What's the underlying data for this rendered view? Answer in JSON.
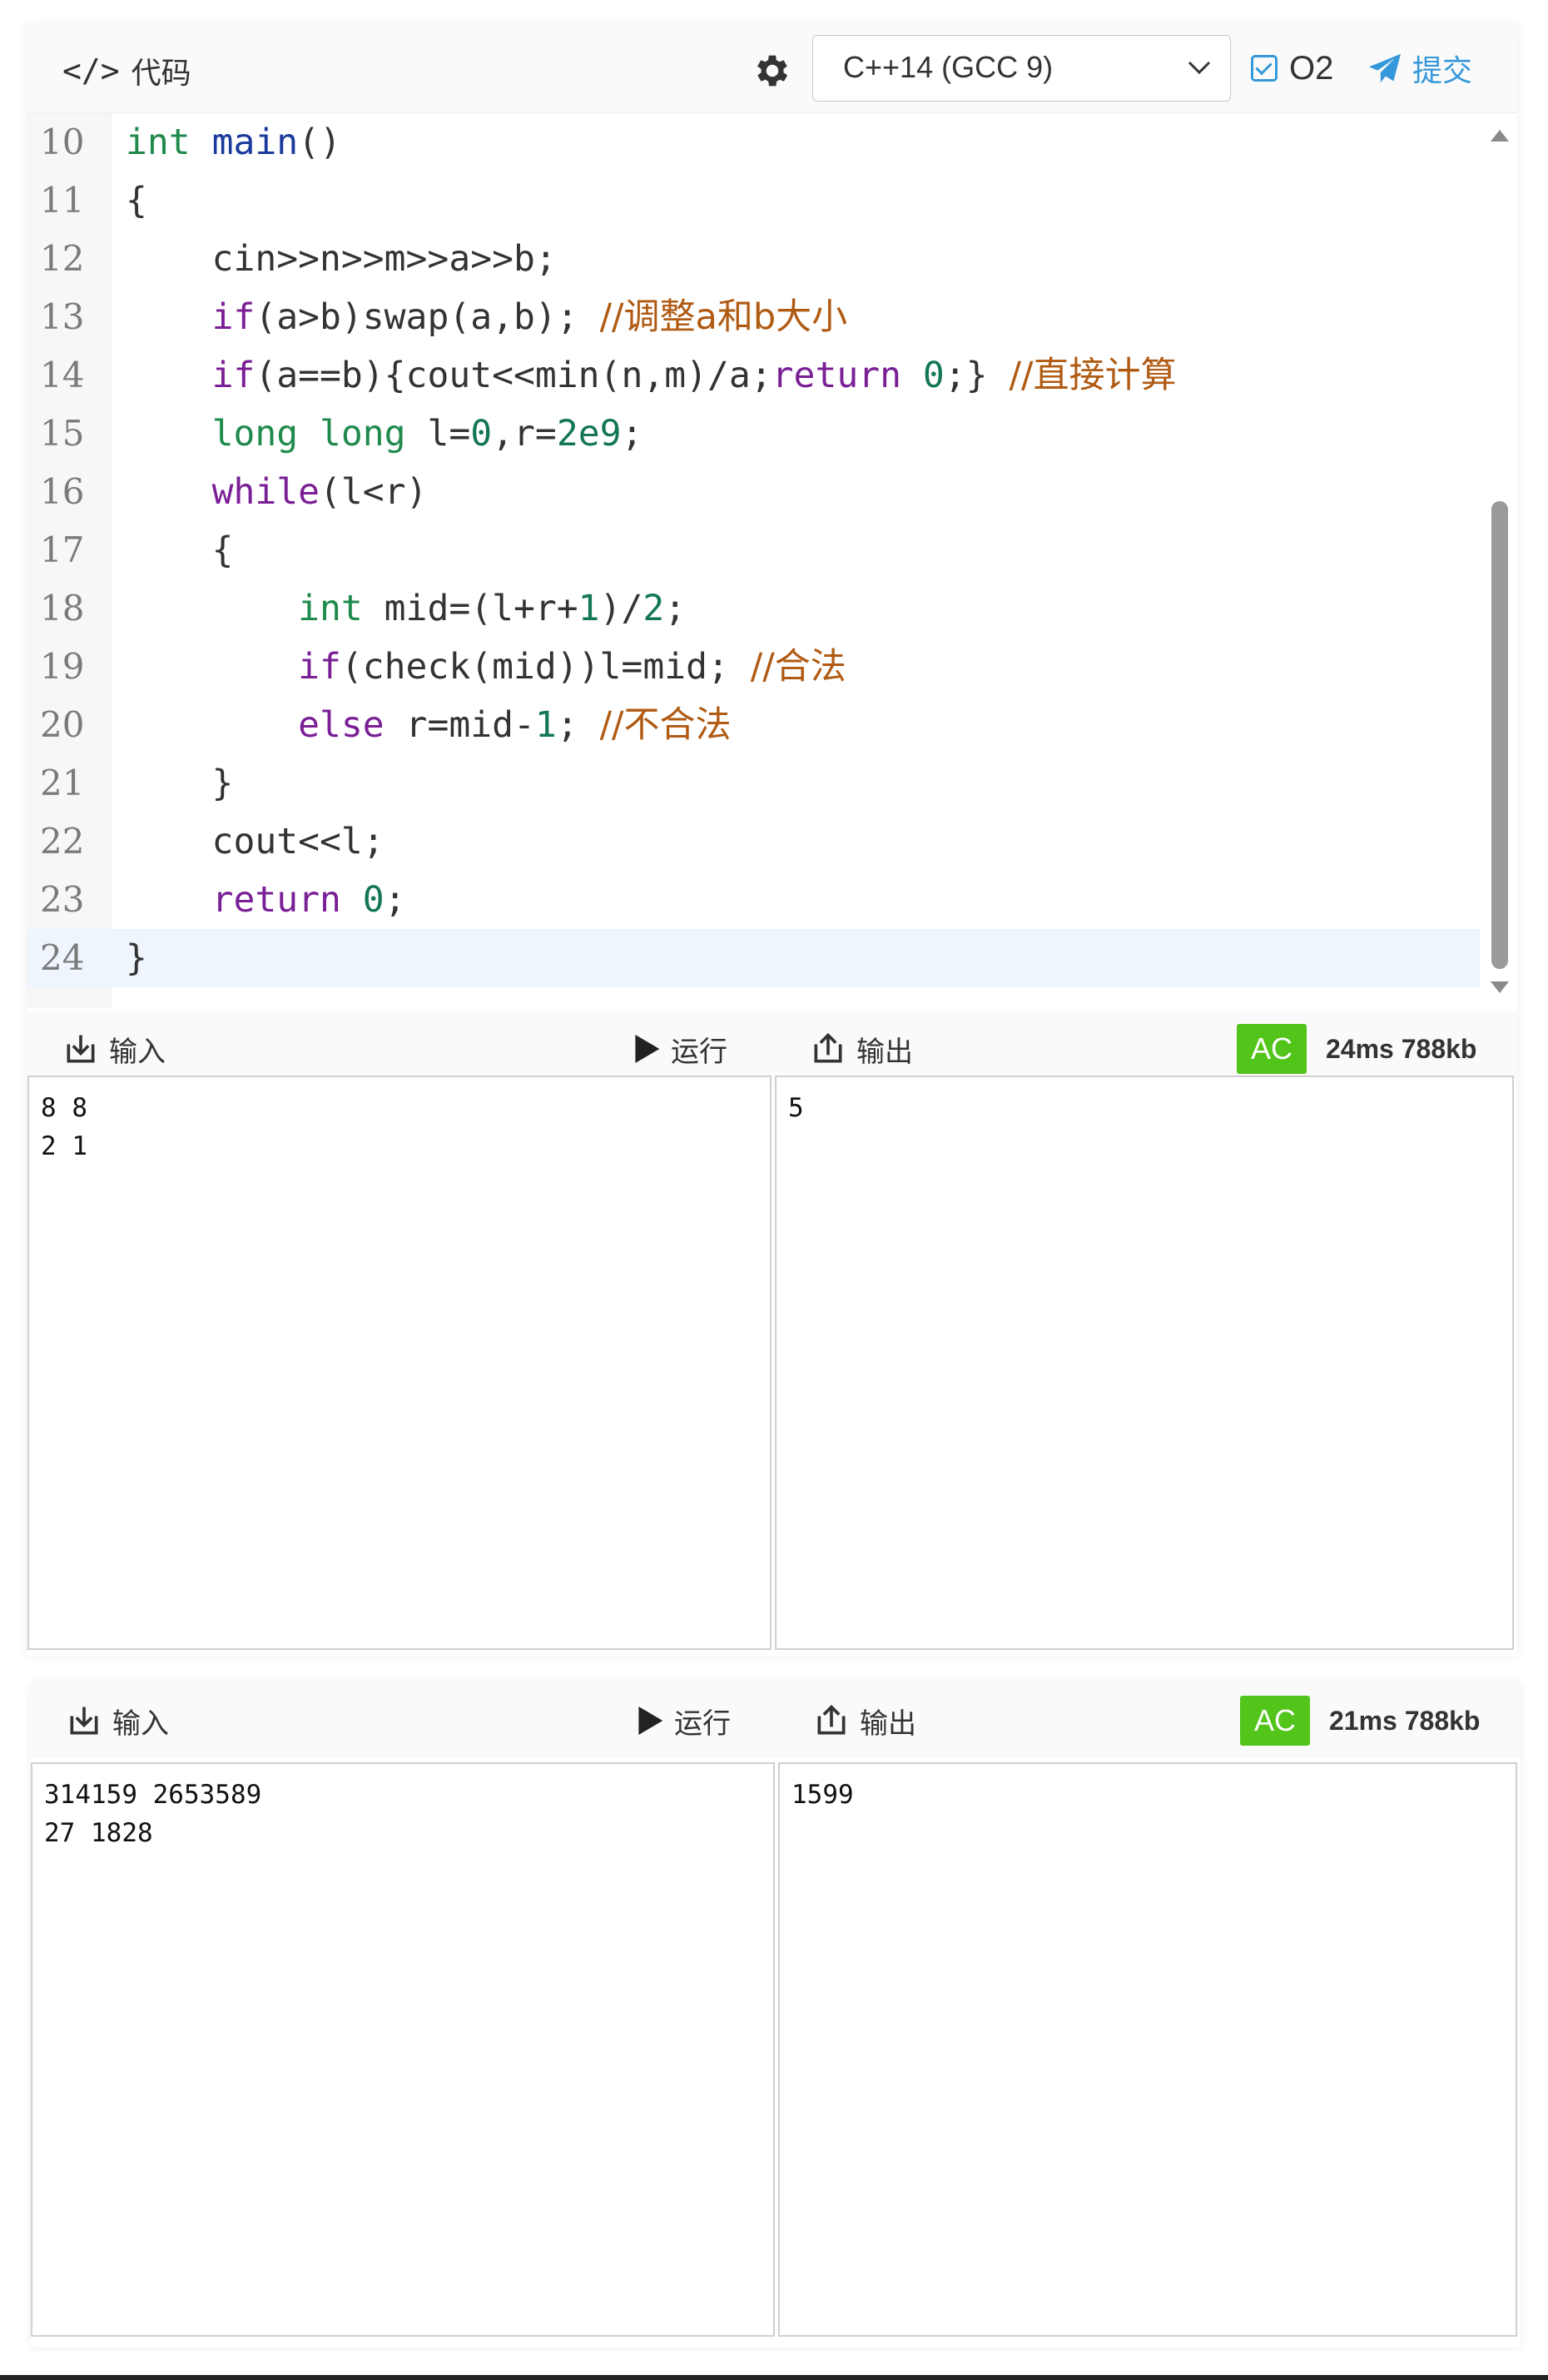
{
  "header": {
    "code_icon": "</>",
    "title": "代码",
    "language": "C++14 (GCC 9)",
    "o2_label": "O2",
    "o2_checked": true,
    "submit_label": "提交",
    "accent_color": "#3498db"
  },
  "editor": {
    "lines": [
      {
        "n": "10"
      },
      {
        "n": "11"
      },
      {
        "n": "12"
      },
      {
        "n": "13"
      },
      {
        "n": "14"
      },
      {
        "n": "15"
      },
      {
        "n": "16"
      },
      {
        "n": "17"
      },
      {
        "n": "18"
      },
      {
        "n": "19"
      },
      {
        "n": "20"
      },
      {
        "n": "21"
      },
      {
        "n": "22"
      },
      {
        "n": "23"
      },
      {
        "n": "24"
      }
    ],
    "code": {
      "l10_kw": "int",
      "l10_fn": "main",
      "l10_rest": "()",
      "l11": "{",
      "l12": "    cin>>n>>m>>a>>b;",
      "l13_kw": "if",
      "l13_rest": "(a>b)swap(a,b); ",
      "l13_cm": "//调整a和b大小",
      "l14_kw": "if",
      "l14_a": "(a==b){cout<<min(n,m)/a;",
      "l14_ret": "return",
      "l14_num": "0",
      "l14_b": ";} ",
      "l14_cm": "//直接计算",
      "l15_ty1": "long",
      "l15_ty2": "long",
      "l15_a": " l=",
      "l15_n1": "0",
      "l15_b": ",r=",
      "l15_n2": "2e9",
      "l15_c": ";",
      "l16_kw": "while",
      "l16_rest": "(l<r)",
      "l17": "    {",
      "l18_ty": "int",
      "l18_a": " mid=(l+r+",
      "l18_n1": "1",
      "l18_b": ")/",
      "l18_n2": "2",
      "l18_c": ";",
      "l19_kw": "if",
      "l19_rest": "(check(mid))l=mid; ",
      "l19_cm": "//合法",
      "l20_kw": "else",
      "l20_a": " r=mid-",
      "l20_n": "1",
      "l20_b": "; ",
      "l20_cm": "//不合法",
      "l21": "    }",
      "l22": "    cout<<l;",
      "l23_kw": "return",
      "l23_num": "0",
      "l23_rest": ";",
      "l24": "}"
    },
    "active_line": "24"
  },
  "run1": {
    "input_label": "输入",
    "run_label": "运行",
    "output_label": "输出",
    "status": "AC",
    "stats": "24ms 788kb",
    "input": "8 8\n2 1",
    "output": "5"
  },
  "run2": {
    "input_label": "输入",
    "run_label": "运行",
    "output_label": "输出",
    "status": "AC",
    "stats": "21ms 788kb",
    "input": "314159 2653589\n27 1828",
    "output": "1599"
  },
  "colors": {
    "ac_green": "#52c41a",
    "keyword": "#7a1f96",
    "type": "#1f8a4c",
    "comment": "#b05a12"
  },
  "icons": [
    "code-icon",
    "gear-icon",
    "chevron-down-icon",
    "checkbox-icon",
    "send-icon",
    "import-icon",
    "play-icon",
    "export-icon"
  ]
}
